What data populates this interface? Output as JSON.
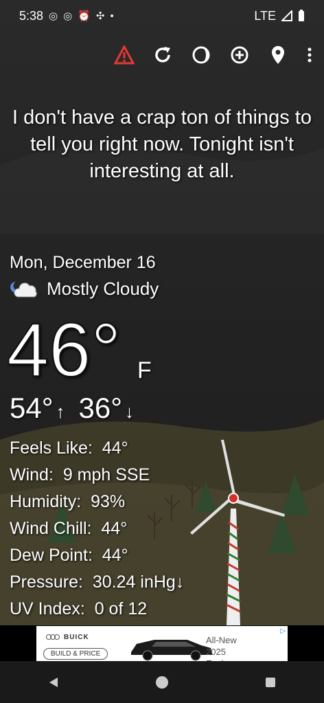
{
  "status": {
    "time": "5:38",
    "network": "LTE"
  },
  "toolbar": {
    "alert_icon": "warning-triangle-icon",
    "refresh_icon": "refresh-icon",
    "theme_icon": "moon-globe-icon",
    "add_icon": "add-circle-icon",
    "location_icon": "location-pin-icon",
    "menu_icon": "overflow-menu-icon",
    "alert_color": "#e53935"
  },
  "headline": "I don't have a crap ton of things to tell you right now. Tonight isn't interesting at all.",
  "weather": {
    "date": "Mon, December 16",
    "condition": "Mostly Cloudy",
    "condition_icon": "night-cloudy-icon",
    "temperature": "46°",
    "unit": "F",
    "high": "54°",
    "high_arrow": "↑",
    "low": "36°",
    "low_arrow": "↓"
  },
  "details": [
    {
      "label": "Feels Like:",
      "value": "44°"
    },
    {
      "label": "Wind:",
      "value": "9 mph SSE"
    },
    {
      "label": "Humidity:",
      "value": "93%"
    },
    {
      "label": "Wind Chill:",
      "value": "44°"
    },
    {
      "label": "Dew Point:",
      "value": "44°"
    },
    {
      "label": "Pressure:",
      "value": "30.24 inHg↓"
    },
    {
      "label": "UV Index:",
      "value": "0 of 12"
    }
  ],
  "ad": {
    "brand": "BUICK",
    "cta": "BUILD & PRICE",
    "line1": "All-New",
    "line2": "2025",
    "line3": "Enclave"
  }
}
